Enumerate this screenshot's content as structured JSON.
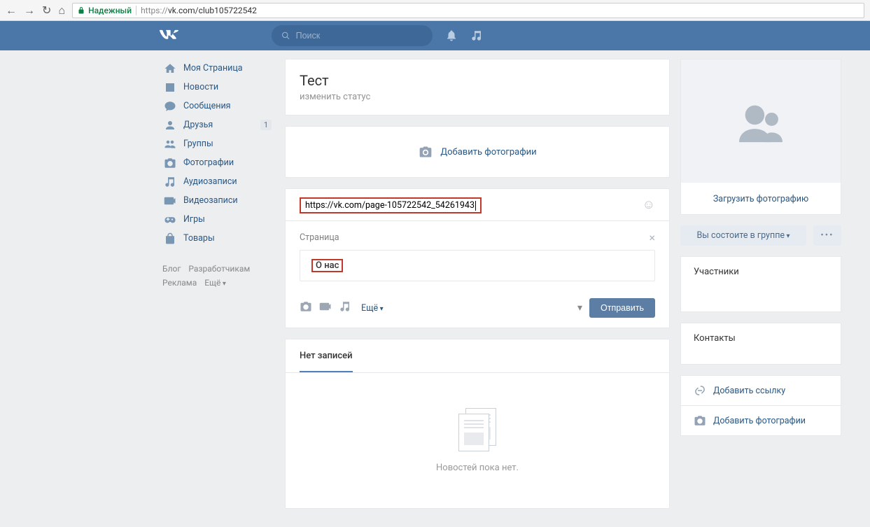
{
  "browser": {
    "secure_label": "Надежный",
    "url_prefix": "https://",
    "url_rest": "vk.com/club105722542"
  },
  "header": {
    "search_placeholder": "Поиск"
  },
  "nav": {
    "items": [
      {
        "label": "Моя Страница",
        "icon": "home"
      },
      {
        "label": "Новости",
        "icon": "news"
      },
      {
        "label": "Сообщения",
        "icon": "messages"
      },
      {
        "label": "Друзья",
        "icon": "friends",
        "badge": "1"
      },
      {
        "label": "Группы",
        "icon": "groups"
      },
      {
        "label": "Фотографии",
        "icon": "photos"
      },
      {
        "label": "Аудиозаписи",
        "icon": "audio"
      },
      {
        "label": "Видеозаписи",
        "icon": "video"
      },
      {
        "label": "Игры",
        "icon": "games"
      },
      {
        "label": "Товары",
        "icon": "market"
      }
    ],
    "footer": {
      "blog": "Блог",
      "developers": "Разработчикам",
      "ads": "Реклама",
      "more": "Ещё"
    }
  },
  "group": {
    "title": "Тест",
    "status_cta": "изменить статус"
  },
  "add_photos": {
    "label": "Добавить фотографии"
  },
  "composer": {
    "value": "https://vk.com/page-105722542_54261943",
    "attach_label": "Страница",
    "attach_title": "О нас",
    "more": "Ещё",
    "send": "Отправить"
  },
  "wall": {
    "tab": "Нет записей",
    "empty": "Новостей пока нет."
  },
  "cover": {
    "upload": "Загрузить фотографию",
    "member": "Вы состоите в группе",
    "dots": "•••"
  },
  "right": {
    "participants": "Участники",
    "contacts": "Контакты",
    "add_link": "Добавить ссылку",
    "add_photo": "Добавить фотографии"
  }
}
